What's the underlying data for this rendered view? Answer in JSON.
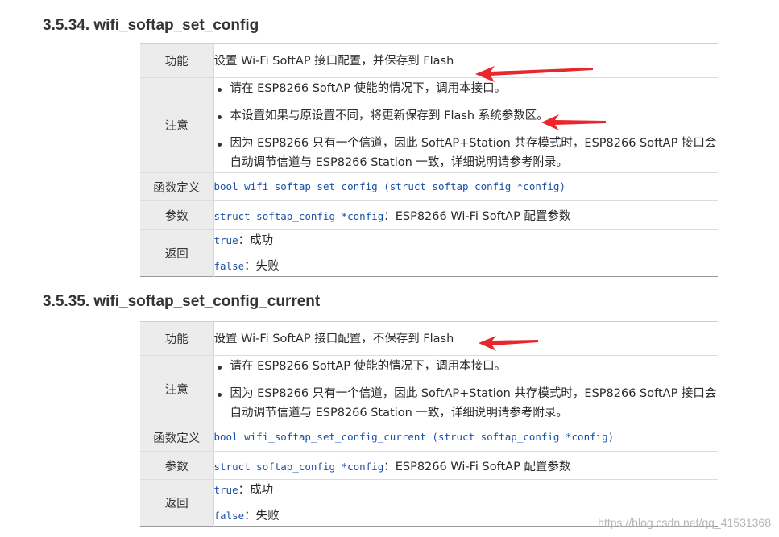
{
  "sections": [
    {
      "title": "3.5.34. wifi_softap_set_config",
      "rows": {
        "function": {
          "label": "功能",
          "value": "设置 Wi-Fi SoftAP 接口配置，并保存到 Flash"
        },
        "notes": {
          "label": "注意",
          "items": [
            "请在 ESP8266 SoftAP 使能的情况下，调用本接口。",
            "本设置如果与原设置不同，将更新保存到 Flash 系统参数区。",
            [
              "因为 ESP8266 只有一个信道，因此 SoftAP+Station 共存模式时，ESP8266 SoftAP 接口会",
              "自动调节信道与 ESP8266 Station 一致，详细说明请参考附录。"
            ]
          ]
        },
        "definition": {
          "label": "函数定义",
          "code": "bool wifi_softap_set_config (struct softap_config *config)"
        },
        "params": {
          "label": "参数",
          "code": "struct softap_config *config",
          "desc": "：ESP8266 Wi-Fi SoftAP 配置参数"
        },
        "returns": {
          "label": "返回",
          "items": [
            {
              "code": "true",
              "desc": "：成功"
            },
            {
              "code": "false",
              "desc": "：失败"
            }
          ]
        }
      }
    },
    {
      "title": "3.5.35. wifi_softap_set_config_current",
      "rows": {
        "function": {
          "label": "功能",
          "value": "设置 Wi-Fi SoftAP 接口配置，不保存到 Flash"
        },
        "notes": {
          "label": "注意",
          "items": [
            "请在 ESP8266 SoftAP 使能的情况下，调用本接口。",
            [
              "因为 ESP8266 只有一个信道，因此 SoftAP+Station 共存模式时，ESP8266 SoftAP 接口会",
              "自动调节信道与 ESP8266 Station 一致，详细说明请参考附录。"
            ]
          ]
        },
        "definition": {
          "label": "函数定义",
          "code": "bool wifi_softap_set_config_current (struct softap_config *config)"
        },
        "params": {
          "label": "参数",
          "code": "struct softap_config *config",
          "desc": "：ESP8266 Wi-Fi SoftAP 配置参数"
        },
        "returns": {
          "label": "返回",
          "items": [
            {
              "code": "true",
              "desc": "：成功"
            },
            {
              "code": "false",
              "desc": "：失败"
            }
          ]
        }
      }
    }
  ],
  "annotation_color": "#e8262b",
  "watermark": "https://blog.csdn.net/qq_41531368"
}
